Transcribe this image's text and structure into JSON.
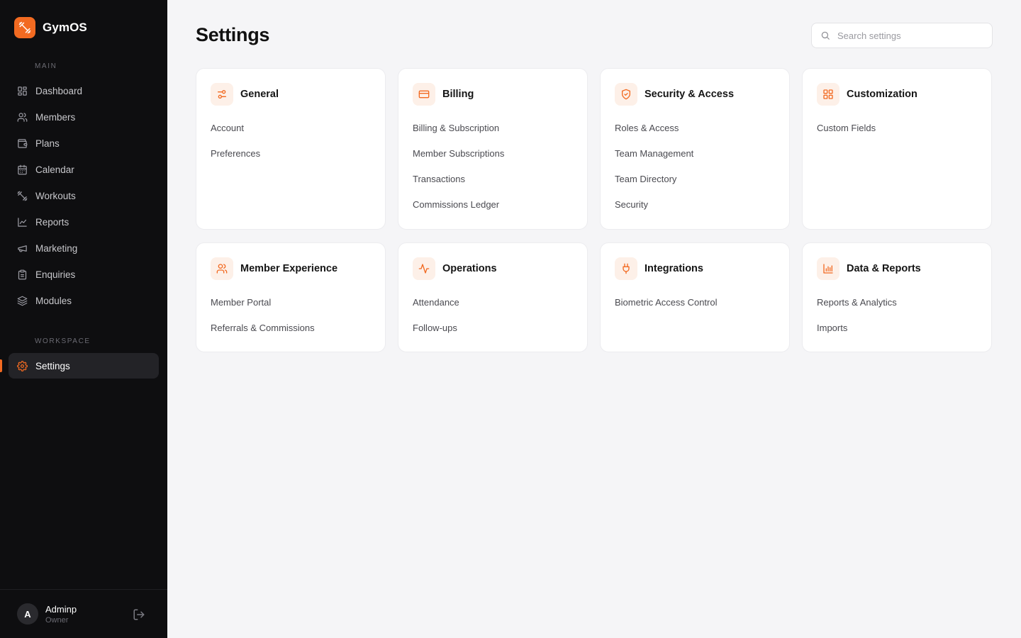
{
  "brand": {
    "name": "GymOS",
    "logo_icon": "dumbbell-icon",
    "accent": "#f26a21"
  },
  "sidebar": {
    "main_label": "MAIN",
    "workspace_label": "WORKSPACE",
    "main_items": [
      {
        "label": "Dashboard",
        "icon": "grid-icon"
      },
      {
        "label": "Members",
        "icon": "users-icon"
      },
      {
        "label": "Plans",
        "icon": "wallet-icon"
      },
      {
        "label": "Calendar",
        "icon": "calendar-icon"
      },
      {
        "label": "Workouts",
        "icon": "dumbbell-icon"
      },
      {
        "label": "Reports",
        "icon": "line-chart-icon"
      },
      {
        "label": "Marketing",
        "icon": "megaphone-icon"
      },
      {
        "label": "Enquiries",
        "icon": "clipboard-icon"
      },
      {
        "label": "Modules",
        "icon": "layers-icon"
      }
    ],
    "workspace_items": [
      {
        "label": "Settings",
        "icon": "gear-icon",
        "active": true
      }
    ]
  },
  "user": {
    "initial": "A",
    "name": "Adminp",
    "role": "Owner"
  },
  "header": {
    "title": "Settings",
    "search_placeholder": "Search settings"
  },
  "cards": [
    {
      "title": "General",
      "icon": "sliders-icon",
      "links": [
        "Account",
        "Preferences"
      ]
    },
    {
      "title": "Billing",
      "icon": "credit-card-icon",
      "links": [
        "Billing & Subscription",
        "Member Subscriptions",
        "Transactions",
        "Commissions Ledger"
      ]
    },
    {
      "title": "Security & Access",
      "icon": "shield-check-icon",
      "links": [
        "Roles & Access",
        "Team Management",
        "Team Directory",
        "Security"
      ]
    },
    {
      "title": "Customization",
      "icon": "layout-grid-icon",
      "links": [
        "Custom Fields"
      ]
    },
    {
      "title": "Member Experience",
      "icon": "users-icon",
      "links": [
        "Member Portal",
        "Referrals & Commissions"
      ]
    },
    {
      "title": "Operations",
      "icon": "activity-icon",
      "links": [
        "Attendance",
        "Follow-ups"
      ]
    },
    {
      "title": "Integrations",
      "icon": "plug-icon",
      "links": [
        "Biometric Access Control"
      ]
    },
    {
      "title": "Data & Reports",
      "icon": "bar-chart-icon",
      "links": [
        "Reports & Analytics",
        "Imports"
      ]
    }
  ]
}
